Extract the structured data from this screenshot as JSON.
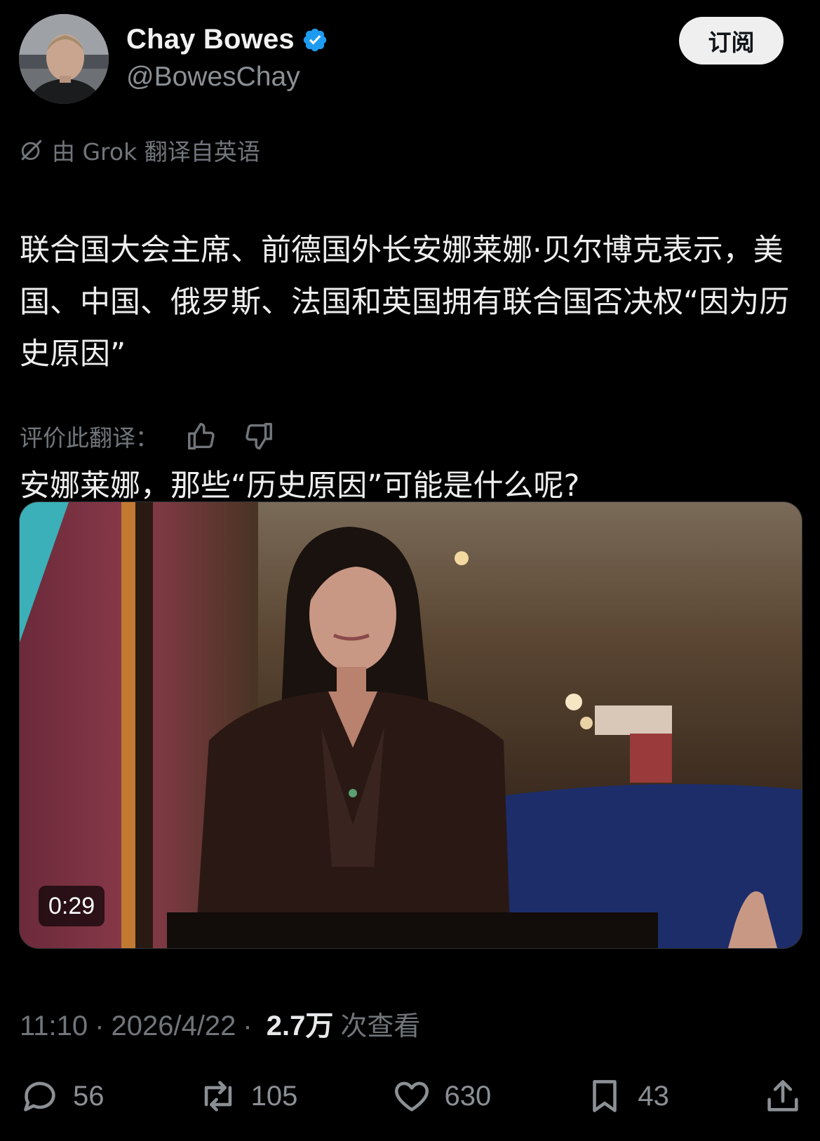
{
  "author": {
    "display_name": "Chay Bowes",
    "handle": "@BowesChay",
    "verified": true
  },
  "subscribe_label": "订阅",
  "translation_note": "由 Grok 翻译自英语",
  "tweet_paragraphs": [
    "联合国大会主席、前德国外长安娜莱娜·贝尔博克表示，美国、中国、俄罗斯、法国和英国拥有联合国否决权“因为历史原因”",
    "安娜莱娜，那些“历史原因”可能是什么呢?"
  ],
  "rate_translation_label": "评价此翻译：",
  "video": {
    "duration": "0:29"
  },
  "meta": {
    "time": "11:10",
    "date": "2026/4/22",
    "views_count": "2.7万",
    "views_label": "次查看",
    "separator": "·"
  },
  "actions": {
    "replies": "56",
    "reposts": "105",
    "likes": "630",
    "bookmarks": "43"
  },
  "colors": {
    "background": "#000000",
    "text": "#e7e9ea",
    "muted": "#71767b",
    "verified": "#1d9bf0"
  },
  "icons": [
    "verified-badge-icon",
    "grok-icon",
    "thumbs-up-icon",
    "thumbs-down-icon",
    "reply-icon",
    "repost-icon",
    "like-icon",
    "bookmark-icon",
    "share-icon"
  ]
}
